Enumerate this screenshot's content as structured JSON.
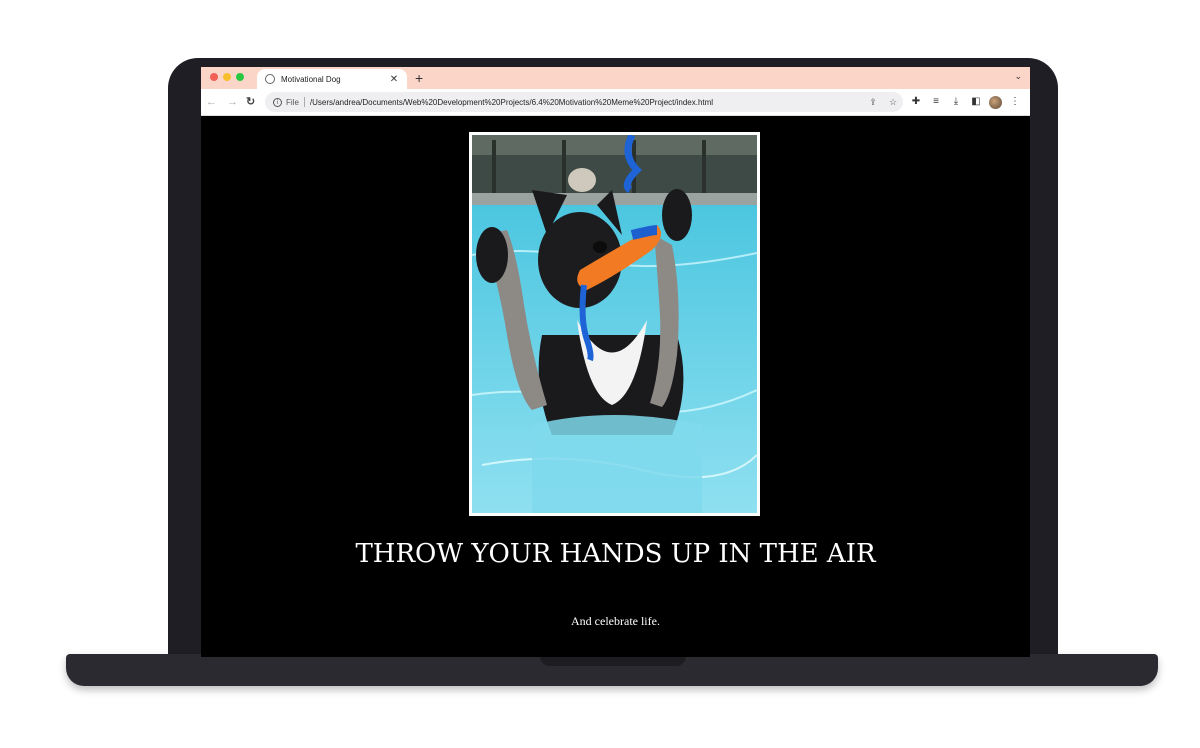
{
  "browser": {
    "tab_title": "Motivational Dog",
    "new_tab_symbol": "+",
    "tab_close_symbol": "✕",
    "scheme_label": "File",
    "url": "/Users/andrea/Documents/Web%20Development%20Projects/6.4%20Motivation%20Meme%20Project/index.html",
    "icons": [
      "back-arrow-icon",
      "forward-arrow-icon",
      "reload-icon",
      "info-icon",
      "share-icon",
      "star-icon",
      "extensions-icon",
      "reading-list-icon",
      "download-icon",
      "side-panel-icon",
      "avatar",
      "more-menu-icon"
    ]
  },
  "page": {
    "headline": "THROW YOUR HANDS UP IN THE AIR",
    "subline": "And celebrate life.",
    "image_subject": "dog in pool holding toy"
  },
  "colors": {
    "tab_strip": "#fbd6c8",
    "page_background": "#000000",
    "text": "#ffffff",
    "frame_border": "#ffffff"
  }
}
